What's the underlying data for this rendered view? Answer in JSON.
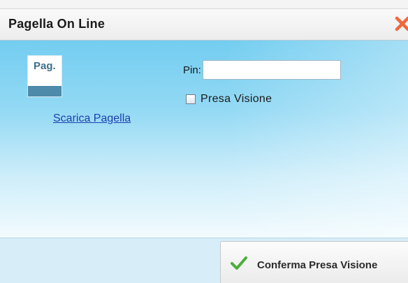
{
  "dialog": {
    "title": "Pagella On Line",
    "close_icon": "close-icon"
  },
  "document": {
    "icon_text": "Pag.",
    "download_link": "Scarica Pagella"
  },
  "form": {
    "pin_label": "Pin:",
    "pin_value": "",
    "checkbox_label": "Presa Visione",
    "checkbox_checked": false
  },
  "footer": {
    "confirm_label": "Conferma Presa Visione",
    "confirm_icon": "check-icon"
  },
  "colors": {
    "accent_close": "#f0683c",
    "body_gradient_top": "#73cdf0",
    "link": "#1c3fb0",
    "check_green": "#4cae3a"
  }
}
